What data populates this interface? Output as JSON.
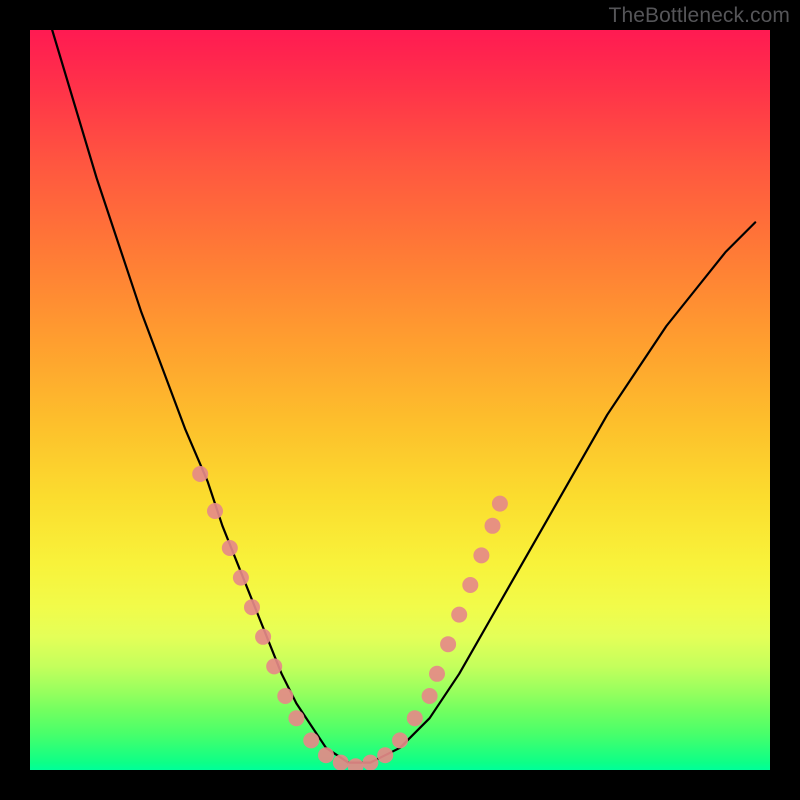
{
  "watermark": "TheBottleneck.com",
  "chart_data": {
    "type": "line",
    "title": "",
    "xlabel": "",
    "ylabel": "",
    "xlim": [
      0,
      100
    ],
    "ylim": [
      0,
      100
    ],
    "series": [
      {
        "name": "curve",
        "color": "#000000",
        "x": [
          3,
          6,
          9,
          12,
          15,
          18,
          21,
          24,
          26,
          28,
          30,
          32,
          34,
          36,
          38,
          40,
          43,
          46,
          50,
          54,
          58,
          62,
          66,
          70,
          74,
          78,
          82,
          86,
          90,
          94,
          98
        ],
        "y": [
          100,
          90,
          80,
          71,
          62,
          54,
          46,
          39,
          33,
          28,
          23,
          18,
          13,
          9,
          6,
          3,
          1,
          1,
          3,
          7,
          13,
          20,
          27,
          34,
          41,
          48,
          54,
          60,
          65,
          70,
          74
        ]
      }
    ],
    "markers": {
      "name": "pink-dots",
      "color": "#e58a88",
      "points": [
        {
          "x": 23,
          "y": 40
        },
        {
          "x": 25,
          "y": 35
        },
        {
          "x": 27,
          "y": 30
        },
        {
          "x": 28.5,
          "y": 26
        },
        {
          "x": 30,
          "y": 22
        },
        {
          "x": 31.5,
          "y": 18
        },
        {
          "x": 33,
          "y": 14
        },
        {
          "x": 34.5,
          "y": 10
        },
        {
          "x": 36,
          "y": 7
        },
        {
          "x": 38,
          "y": 4
        },
        {
          "x": 40,
          "y": 2
        },
        {
          "x": 42,
          "y": 1
        },
        {
          "x": 44,
          "y": 0.5
        },
        {
          "x": 46,
          "y": 1
        },
        {
          "x": 48,
          "y": 2
        },
        {
          "x": 50,
          "y": 4
        },
        {
          "x": 52,
          "y": 7
        },
        {
          "x": 54,
          "y": 10
        },
        {
          "x": 55,
          "y": 13
        },
        {
          "x": 56.5,
          "y": 17
        },
        {
          "x": 58,
          "y": 21
        },
        {
          "x": 59.5,
          "y": 25
        },
        {
          "x": 61,
          "y": 29
        },
        {
          "x": 62.5,
          "y": 33
        },
        {
          "x": 63.5,
          "y": 36
        }
      ]
    }
  }
}
